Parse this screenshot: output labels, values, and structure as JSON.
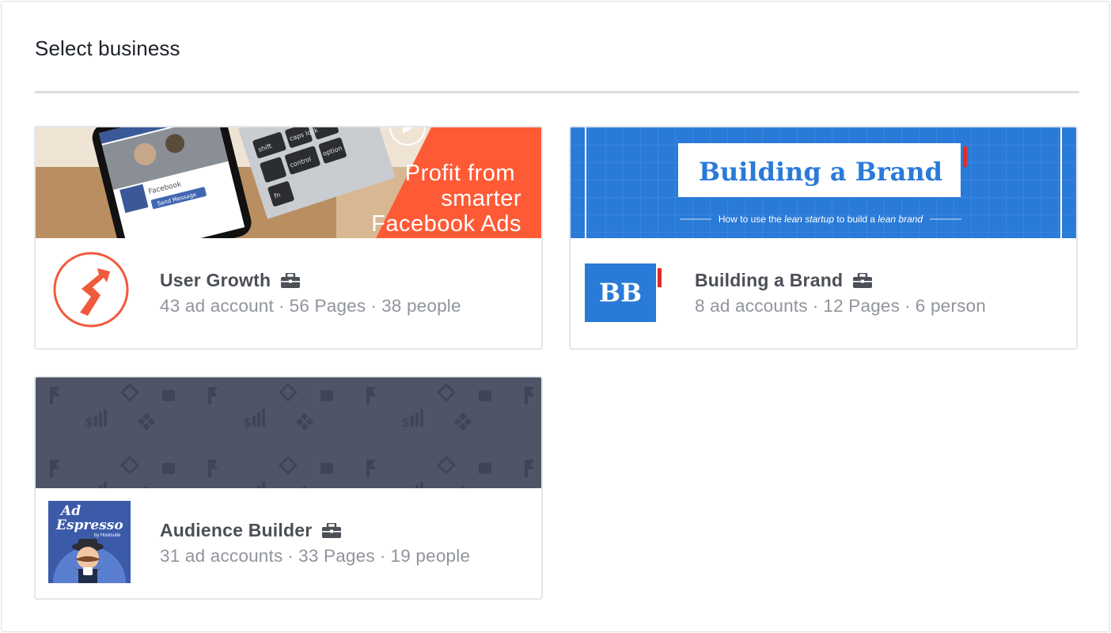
{
  "title": "Select business",
  "businesses": [
    {
      "name": "User Growth",
      "ad_accounts": "43 ad account",
      "pages": "56 Pages",
      "people": "38 people",
      "cover_text": [
        "Profit from",
        "smarter",
        "Facebook Ads"
      ],
      "cover_phone_label": "Facebook",
      "cover_phone_button": "Send Message",
      "cover_key_labels": [
        "shift",
        "control",
        "fn",
        "caps lock",
        "option"
      ]
    },
    {
      "name": "Building a Brand",
      "ad_accounts": "8 ad accounts",
      "pages": "12 Pages",
      "people": "6 person",
      "cover_title": "Building a Brand",
      "cover_subtitle_parts": [
        "How to use the ",
        "lean startup",
        " to build a ",
        "lean brand"
      ],
      "logo_text": "BB"
    },
    {
      "name": "Audience Builder",
      "ad_accounts": "31 ad accounts",
      "pages": "33 Pages",
      "people": "19 people",
      "logo_text": [
        "Ad",
        "Espresso",
        "by Hootsuite"
      ]
    }
  ],
  "separator": "·",
  "colors": {
    "brand_orange": "#ff5a36",
    "brand_blue": "#2a7ad8",
    "slate_cover": "#4f5567",
    "accent_red": "#e02b2b",
    "adespresso_blue": "#3b5ba8"
  },
  "icons": [
    "briefcase-icon",
    "user-growth-logo",
    "bb-logo",
    "adespresso-logo"
  ]
}
